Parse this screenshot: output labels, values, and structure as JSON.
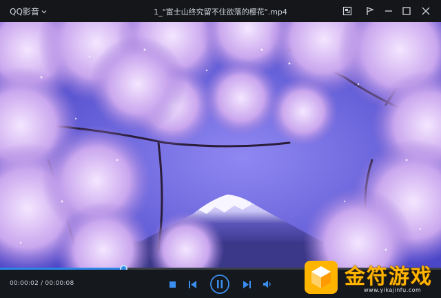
{
  "window": {
    "app_name": "QQ影音",
    "file_title": "1_\"富士山终究留不住欲落的樱花\".mp4"
  },
  "titlebar_icons": [
    "pip-icon",
    "share-icon",
    "minimize-icon",
    "maximize-icon",
    "close-icon"
  ],
  "player": {
    "current_time": "00:00:02",
    "separator": " / ",
    "total_time": "00:00:08",
    "progress_fraction": 0.28,
    "accent_color": "#2e88e8"
  },
  "controls": [
    "stop-icon",
    "previous-icon",
    "pause-icon",
    "next-icon",
    "volume-icon"
  ],
  "watermark": {
    "text": "金符游戏",
    "url": "www.yikajinfu.com",
    "color": "#ffb400"
  }
}
